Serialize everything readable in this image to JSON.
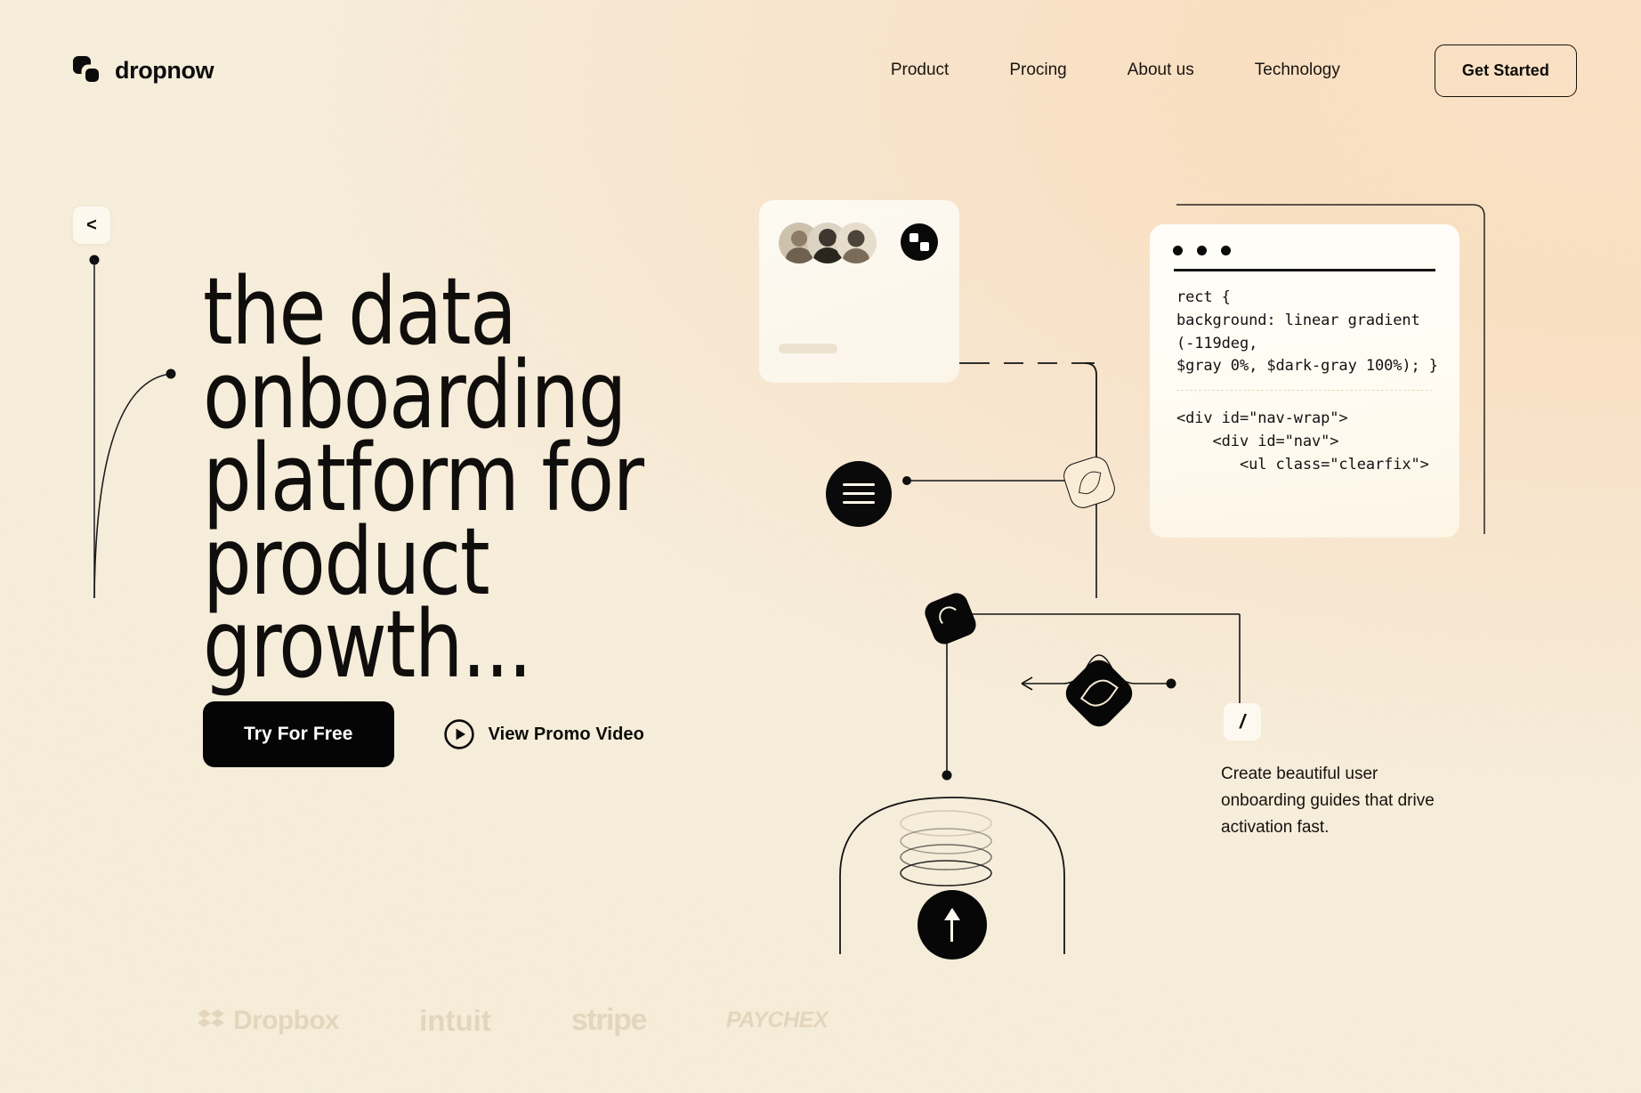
{
  "brand": {
    "name": "dropnow",
    "logo_icon": "two-rounded-squares-logo"
  },
  "nav": {
    "items": [
      {
        "label": "Product"
      },
      {
        "label": "Procing"
      },
      {
        "label": "About us"
      },
      {
        "label": "Technology"
      }
    ],
    "cta_label": "Get Started"
  },
  "hero": {
    "back_badge": "<",
    "headline": "the data\nonboarding\nplatform for\nproduct growth...",
    "primary_cta": "Try For Free",
    "secondary_cta": "View Promo Video",
    "play_icon": "play-circle-icon"
  },
  "partners": [
    {
      "name": "Dropbox",
      "icon": "dropbox-diamond-icon",
      "style": "dropbox"
    },
    {
      "name": "intuit",
      "icon": "",
      "style": "intuit"
    },
    {
      "name": "stripe",
      "icon": "",
      "style": "stripe"
    },
    {
      "name": "PAYCHEX",
      "icon": "",
      "style": "paychex"
    }
  ],
  "composition": {
    "card_top": {
      "avatars_count": 3,
      "chip_icon": "two-squares-circle-icon",
      "placeholder_pill": ""
    },
    "code_window": {
      "window_dots": 3,
      "code_css": "rect {\nbackground: linear gradient\n(-119deg,\n$gray 0%, $dark-gray 100%); }",
      "code_html": "<div id=\"nav-wrap\">\n    <div id=\"nav\">\n       <ul class=\"clearfix\">"
    },
    "nodes": {
      "hamburger_icon": "hamburger-circle-icon",
      "dark_square_icon": "rounded-square-arc-icon",
      "outline_square_icon": "rounded-square-leaf-outline-icon",
      "diamond_icon": "diamond-oval-icon",
      "slash_badge": "/",
      "upload_icon": "up-arrow-circle-icon"
    },
    "feature_caption": "Create beautiful user onboarding guides that drive activation fast."
  },
  "colors": {
    "bg_left": "#f6eed9",
    "bg_right": "#fbe2c5",
    "ink": "#0b0b0b",
    "card": "#fdfaf2",
    "partner_logo": "#e3d6bd"
  }
}
